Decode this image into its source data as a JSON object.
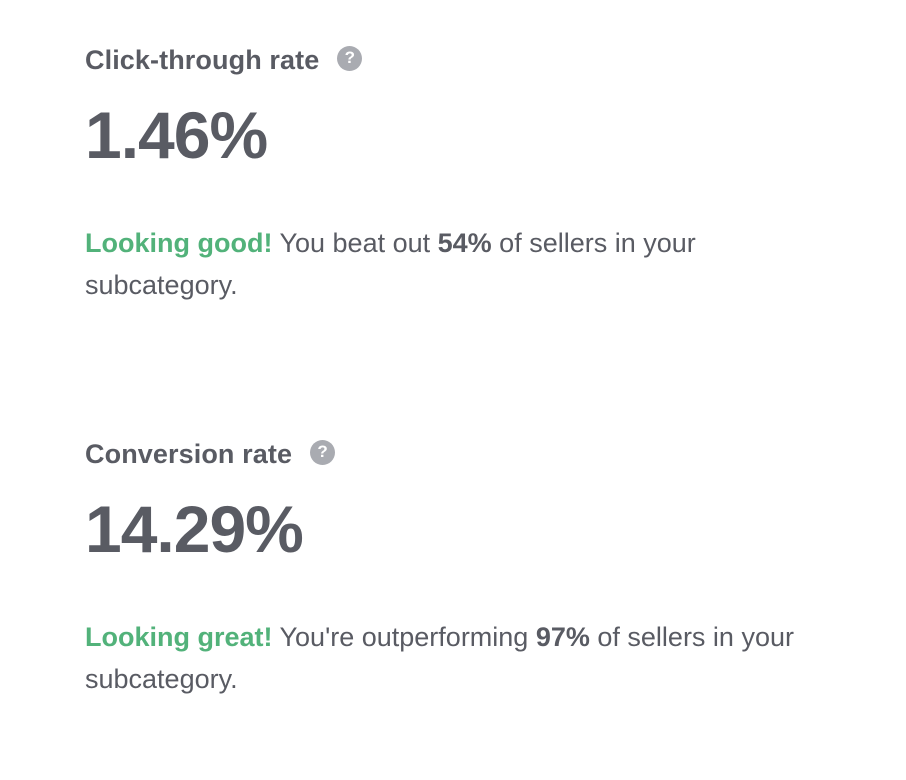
{
  "metrics": [
    {
      "title": "Click-through rate",
      "help_icon": "question-circle-icon",
      "help_glyph": "?",
      "value": "1.46%",
      "message": {
        "highlight": "Looking good!",
        "before": " You beat out ",
        "percent": "54%",
        "after": " of sellers in your subcategory."
      }
    },
    {
      "title": "Conversion rate",
      "help_icon": "question-circle-icon",
      "help_glyph": "?",
      "value": "14.29%",
      "message": {
        "highlight": "Looking great!",
        "before": " You're outperforming ",
        "percent": "97%",
        "after": " of sellers in your subcategory."
      }
    }
  ],
  "colors": {
    "text": "#595b63",
    "highlight": "#52b27a",
    "help_icon_bg": "#a9abb1"
  }
}
